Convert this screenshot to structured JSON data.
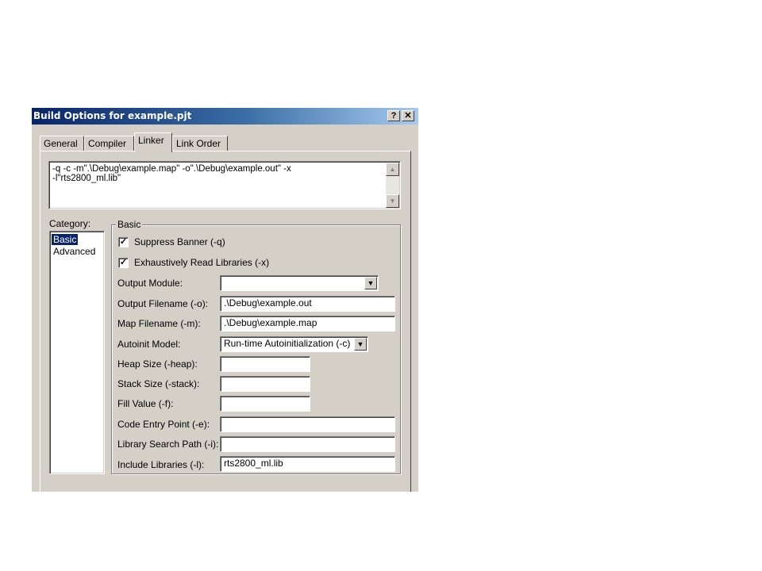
{
  "window": {
    "title": "Build Options for example.pjt",
    "help_label": "?",
    "close_label": "✕"
  },
  "tabs": [
    "General",
    "Compiler",
    "Linker",
    "Link Order"
  ],
  "active_tab": "Linker",
  "command_line": "-q -c -m\".\\Debug\\example.map\" -o\".\\Debug\\example.out\" -x\n-l\"rts2800_ml.lib\"",
  "category": {
    "label": "Category:",
    "items": [
      "Basic",
      "Advanced"
    ],
    "selected": "Basic"
  },
  "group": {
    "title": "Basic",
    "checkboxes": [
      {
        "label": "Suppress Banner (-q)",
        "checked": true,
        "mark": "✓"
      },
      {
        "label": "Exhaustively Read Libraries (-x)",
        "checked": true,
        "mark": "✓"
      }
    ],
    "fields": [
      {
        "label": "Output Module:",
        "value": "",
        "type": "dropdown"
      },
      {
        "label": "Output Filename (-o):",
        "value": ".\\Debug\\example.out"
      },
      {
        "label": "Map Filename (-m):",
        "value": ".\\Debug\\example.map"
      },
      {
        "label": "Autoinit Model:",
        "value": "Run-time Autoinitialization (-c)",
        "type": "dropdown"
      },
      {
        "label": "Heap Size (-heap):",
        "value": ""
      },
      {
        "label": "Stack Size (-stack):",
        "value": ""
      },
      {
        "label": "Fill Value (-f):",
        "value": ""
      },
      {
        "label": "Code Entry Point (-e):",
        "value": ""
      },
      {
        "label": "Library Search Path (-i):",
        "value": ""
      },
      {
        "label": "Include Libraries (-l):",
        "value": "rts2800_ml.lib"
      }
    ]
  },
  "icons": {
    "scroll_up": "▲",
    "scroll_down": "▼",
    "dropdown_arrow": "▼"
  }
}
